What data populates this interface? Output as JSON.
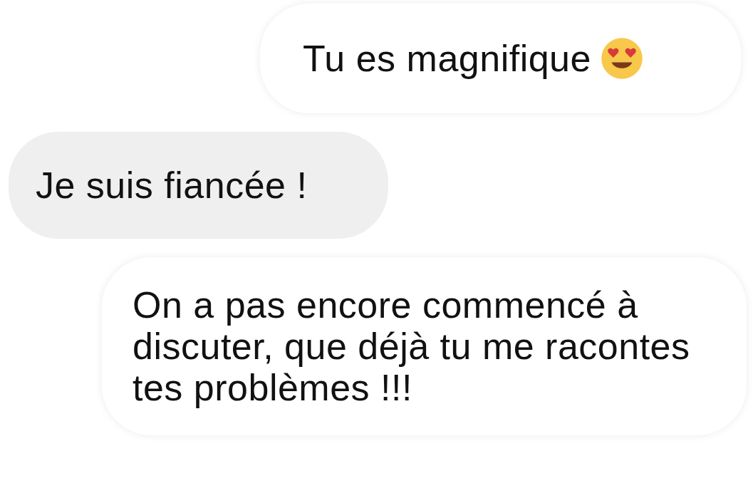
{
  "messages": [
    {
      "kind": "outgoing",
      "text": "Tu es magnifique",
      "emoji": true
    },
    {
      "kind": "incoming",
      "text": "Je suis fiancée !",
      "emoji": false
    },
    {
      "kind": "outgoing",
      "text": "On a pas encore commencé à discuter, que déjà tu me racontes tes problèmes !!!",
      "emoji": false
    }
  ]
}
